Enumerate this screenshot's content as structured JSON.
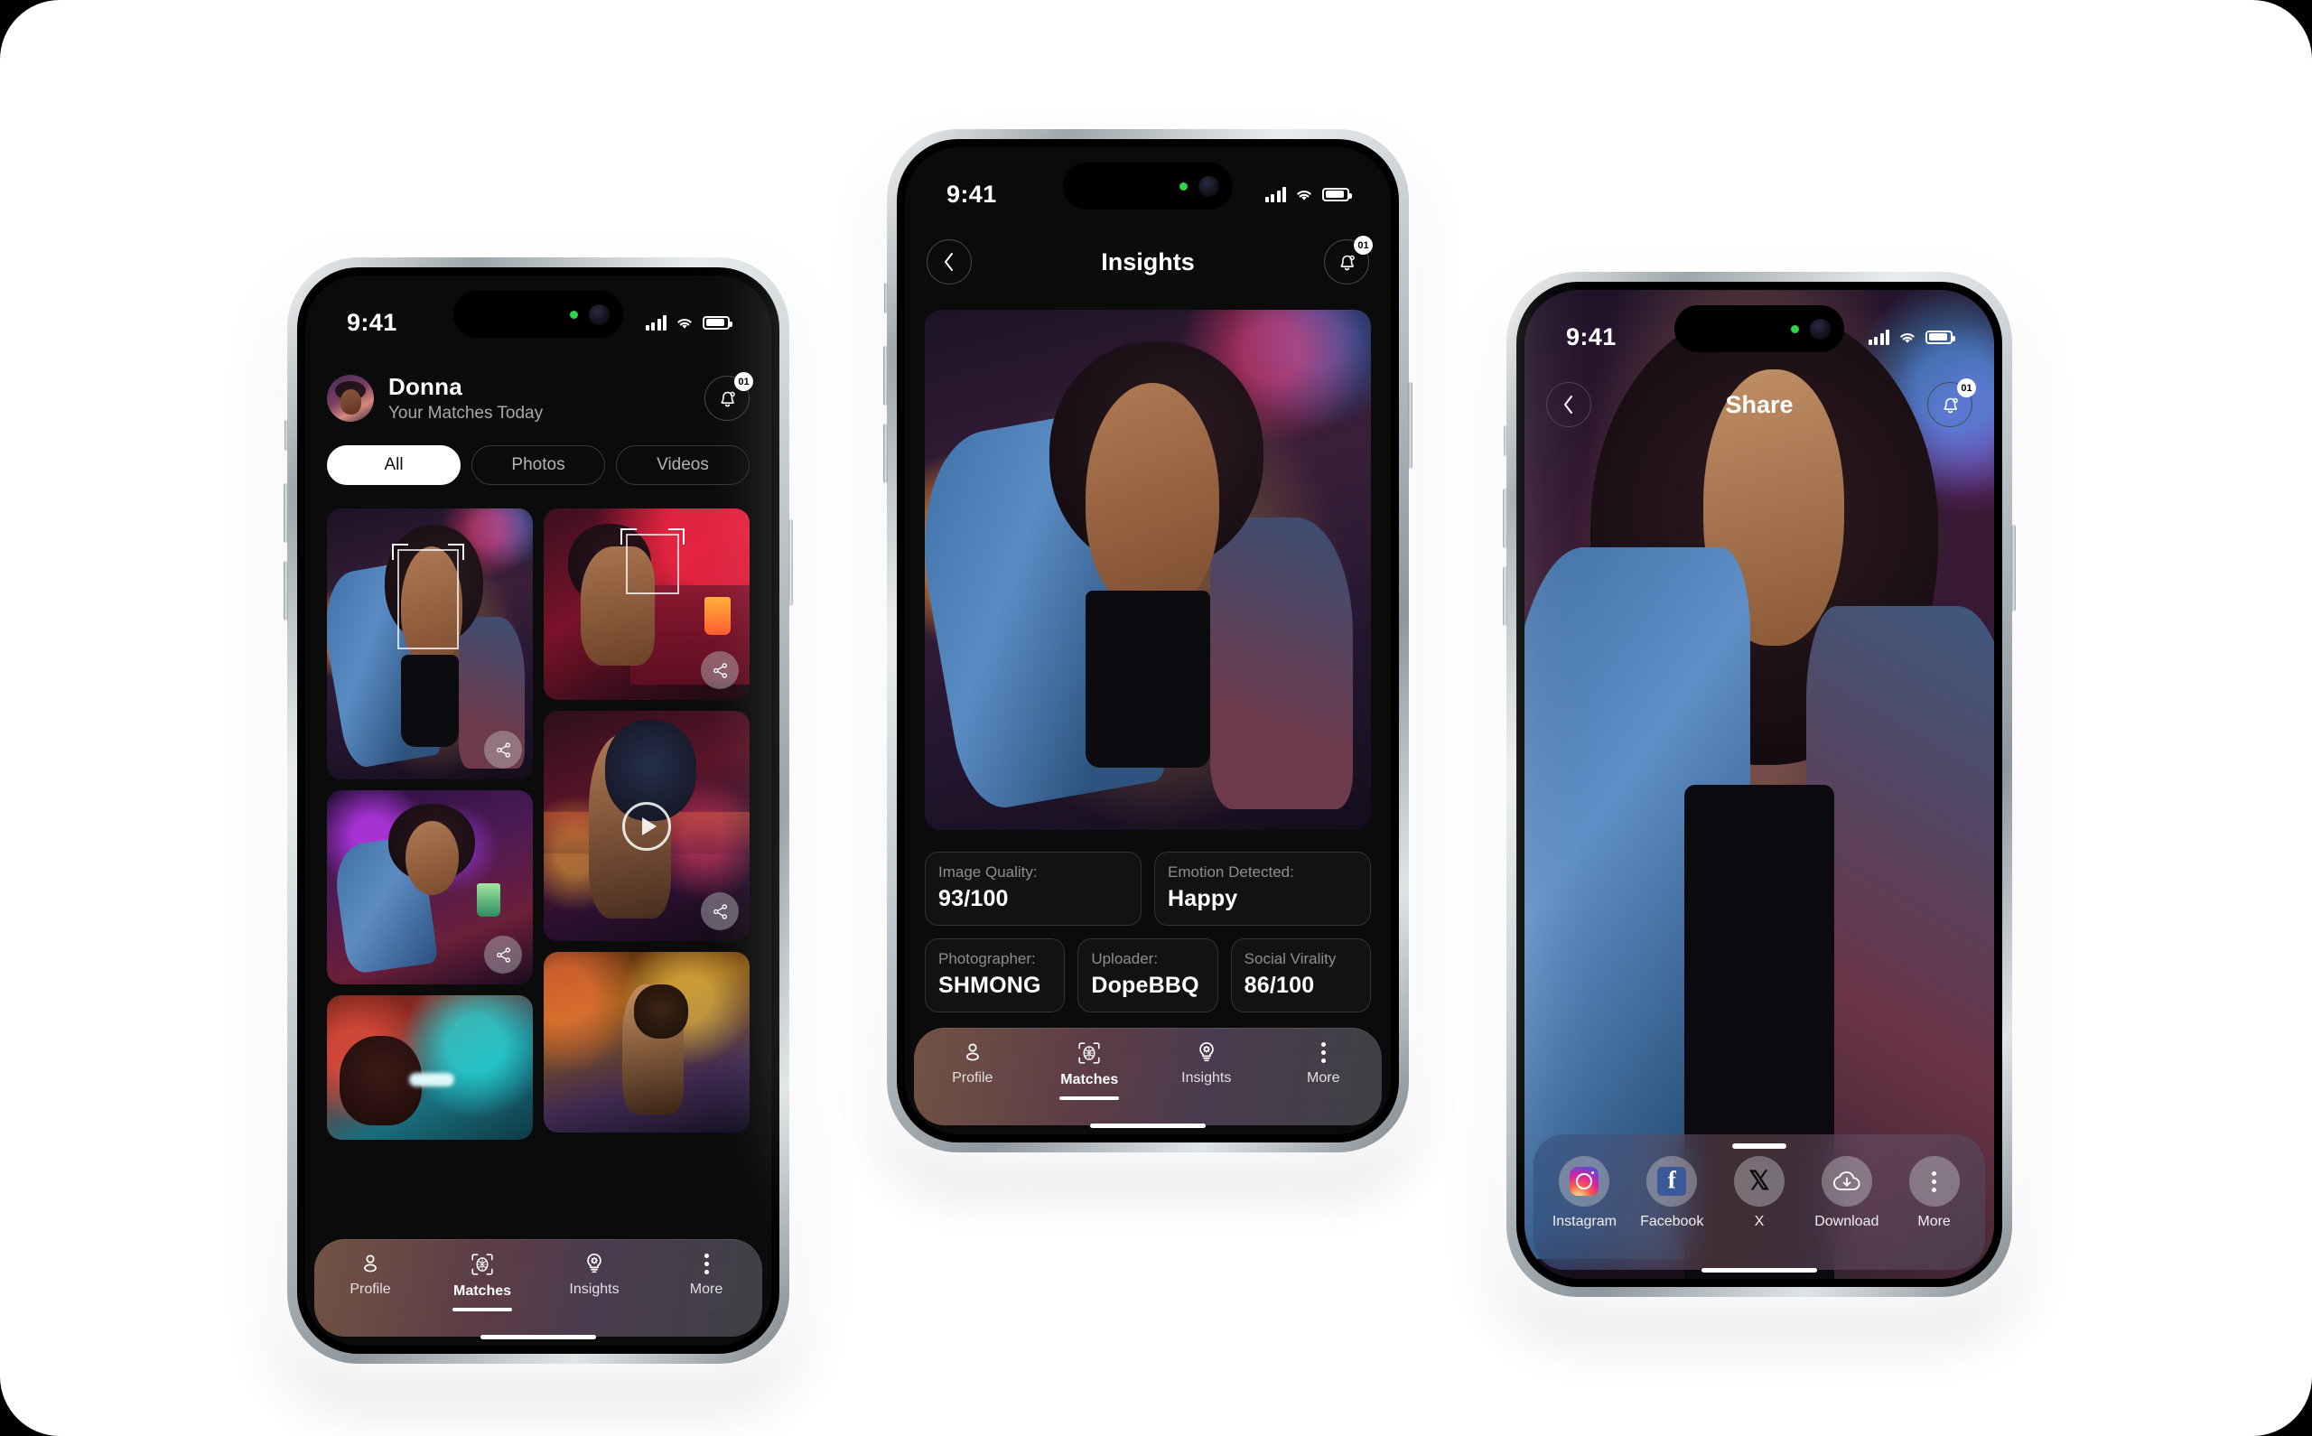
{
  "status_bar": {
    "time": "9:41"
  },
  "matches_screen": {
    "header": {
      "name": "Donna",
      "subtitle": "Your Matches Today",
      "notification_count": "01"
    },
    "filters": [
      {
        "label": "All",
        "active": true
      },
      {
        "label": "Photos",
        "active": false
      },
      {
        "label": "Videos",
        "active": false
      }
    ],
    "tiles": [
      {
        "id": "tile-1",
        "type": "photo",
        "face_detected": true,
        "has_share": true
      },
      {
        "id": "tile-2",
        "type": "photo",
        "face_detected": true,
        "has_share": true
      },
      {
        "id": "tile-3",
        "type": "video",
        "face_detected": false,
        "has_share": true
      },
      {
        "id": "tile-4",
        "type": "photo",
        "face_detected": false,
        "has_share": true
      },
      {
        "id": "tile-5",
        "type": "photo",
        "face_detected": false,
        "has_share": false
      },
      {
        "id": "tile-6",
        "type": "photo",
        "face_detected": false,
        "has_share": false
      }
    ]
  },
  "insights_screen": {
    "title": "Insights",
    "notification_count": "01",
    "cards": [
      {
        "label": "Image Quality:",
        "value": "93/100"
      },
      {
        "label": "Emotion Detected:",
        "value": "Happy"
      },
      {
        "label": "Photographer:",
        "value": "SHMONG"
      },
      {
        "label": "Uploader:",
        "value": "DopeBBQ"
      },
      {
        "label": "Social Virality",
        "value": "86/100"
      }
    ]
  },
  "share_screen": {
    "title": "Share",
    "notification_count": "01",
    "share_targets": [
      {
        "label": "Instagram",
        "icon": "instagram-icon"
      },
      {
        "label": "Facebook",
        "icon": "facebook-icon"
      },
      {
        "label": "X",
        "icon": "x-icon"
      },
      {
        "label": "Download",
        "icon": "cloud-download-icon"
      },
      {
        "label": "More",
        "icon": "more-vertical-icon"
      }
    ]
  },
  "bottom_nav": [
    {
      "label": "Profile",
      "icon": "person-icon",
      "active": false
    },
    {
      "label": "Matches",
      "icon": "face-scan-icon",
      "active": true
    },
    {
      "label": "Insights",
      "icon": "lightbulb-gear-icon",
      "active": false
    },
    {
      "label": "More",
      "icon": "more-vertical-icon",
      "active": false
    }
  ],
  "colors": {
    "canvas": "#ffffff",
    "screen_bg": "#0b0b0c",
    "accent_white": "#ffffff",
    "muted_text": "#8d8d93",
    "card_border": "#333337"
  }
}
